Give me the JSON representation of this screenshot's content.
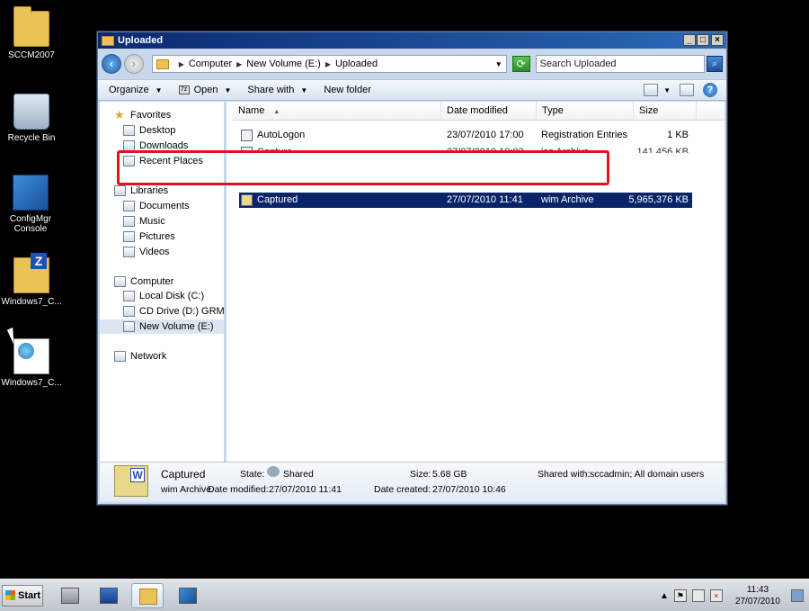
{
  "desktop": {
    "icons": [
      {
        "label": "SCCM2007"
      },
      {
        "label": "Recycle Bin"
      },
      {
        "label": "ConfigMgr Console"
      },
      {
        "label": "Windows7_C..."
      },
      {
        "label": "Windows7_C..."
      }
    ]
  },
  "window": {
    "title": "Uploaded",
    "controls": {
      "minimize": "_",
      "maximize": "□",
      "close": "×"
    }
  },
  "address": {
    "path": [
      "Computer",
      "New Volume (E:)",
      "Uploaded"
    ],
    "search_placeholder": "Search Uploaded"
  },
  "toolbar": {
    "organize": "Organize",
    "open": "Open",
    "share_with": "Share with",
    "new_folder": "New folder"
  },
  "nav": {
    "favorites": "Favorites",
    "desktop": "Desktop",
    "downloads": "Downloads",
    "recent_places": "Recent Places",
    "libraries": "Libraries",
    "documents": "Documents",
    "music": "Music",
    "pictures": "Pictures",
    "videos": "Videos",
    "computer": "Computer",
    "local_disk": "Local Disk (C:)",
    "cd_drive": "CD Drive (D:) GRMSXV",
    "new_volume": "New Volume (E:)",
    "network": "Network"
  },
  "columns": {
    "name": "Name",
    "date": "Date modified",
    "type": "Type",
    "size": "Size"
  },
  "files": [
    {
      "name": "AutoLogon",
      "date": "23/07/2010 17:00",
      "type": "Registration Entries",
      "size": "1 KB"
    },
    {
      "name": "Capture",
      "date": "27/07/2010 10:03",
      "type": "iso Archive",
      "size": "141,456 KB"
    },
    {
      "name": "Captured",
      "date": "27/07/2010 11:41",
      "type": "wim Archive",
      "size": "5,965,376 KB"
    }
  ],
  "details": {
    "name": "Captured",
    "kind": "wim Archive",
    "state_label": "State:",
    "state_value": "Shared",
    "modified_label": "Date modified:",
    "modified_value": "27/07/2010 11:41",
    "size_label": "Size:",
    "size_value": "5.68 GB",
    "created_label": "Date created:",
    "created_value": "27/07/2010 10:46",
    "shared_label": "Shared with:",
    "shared_value": "sccadmin; All domain users"
  },
  "taskbar": {
    "start": "Start",
    "time": "11:43",
    "date": "27/07/2010"
  },
  "colors": {
    "selection": "#0a246a",
    "highlight_box": "#e0141e",
    "titlebar": "#0a2870"
  }
}
